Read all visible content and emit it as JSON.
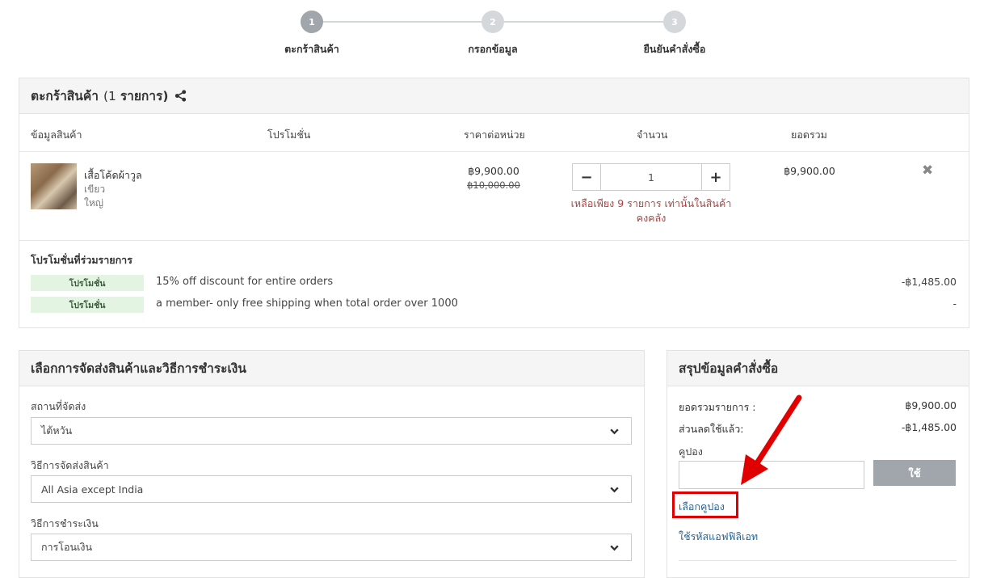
{
  "stepper": {
    "steps": [
      {
        "number": "1",
        "label": "ตะกร้าสินค้า"
      },
      {
        "number": "2",
        "label": "กรอกข้อมูล"
      },
      {
        "number": "3",
        "label": "ยืนยันคำสั่งซื้อ"
      }
    ]
  },
  "cart": {
    "title": "ตะกร้าสินค้า",
    "count_open": "(",
    "count_num": "1",
    "count_word": "รายการ)",
    "columns": {
      "info": "ข้อมูลสินค้า",
      "promo": "โปรโมชั่น",
      "unit_price": "ราคาต่อหน่วย",
      "quantity": "จำนวน",
      "total": "ยอดรวม"
    },
    "item": {
      "name": "เสื้อโค้ดผ้าวูล",
      "color": "เขียว",
      "size": "ใหญ่",
      "price": "฿9,900.00",
      "old_price": "฿10,000.00",
      "quantity": "1",
      "minus": "−",
      "plus": "+",
      "stock_warning": "เหลือเพียง 9 รายการ เท่านั้นในสินค้าคงคลัง",
      "total": "฿9,900.00",
      "remove": "✖"
    },
    "promotions_title": "โปรโมชั่นที่ร่วมรายการ",
    "promotions": [
      {
        "badge": "โปรโมชั่น",
        "text": "15% off discount for entire orders",
        "amount": "-฿1,485.00"
      },
      {
        "badge": "โปรโมชั่น",
        "text": "a member- only free shipping when total order over 1000",
        "amount": "-"
      }
    ]
  },
  "shipping": {
    "title": "เลือกการจัดส่งสินค้าและวิธีการชำระเงิน",
    "location_label": "สถานที่จัดส่ง",
    "location_value": "ไต้หวัน",
    "method_label": "วิธีการจัดส่งสินค้า",
    "method_value": "All Asia except India",
    "payment_label": "วิธีการชำระเงิน",
    "payment_value": "การโอนเงิน"
  },
  "summary": {
    "title": "สรุปข้อมูลคำสั่งซื้อ",
    "subtotal_label": "ยอดรวมรายการ :",
    "subtotal_value": "฿9,900.00",
    "discount_label": "ส่วนลดใช้แล้ว:",
    "discount_value": "-฿1,485.00",
    "coupon_label": "คูปอง",
    "apply_button": "ใช้",
    "choose_coupon": "เลือกคูปอง",
    "affiliate_code": "ใช้รหัสแอฟฟิลิเอท"
  },
  "colors": {
    "accent_link": "#2a6496",
    "warning": "#a94442",
    "highlight": "#e00000",
    "promo_badge_bg": "#e3f4e3"
  }
}
